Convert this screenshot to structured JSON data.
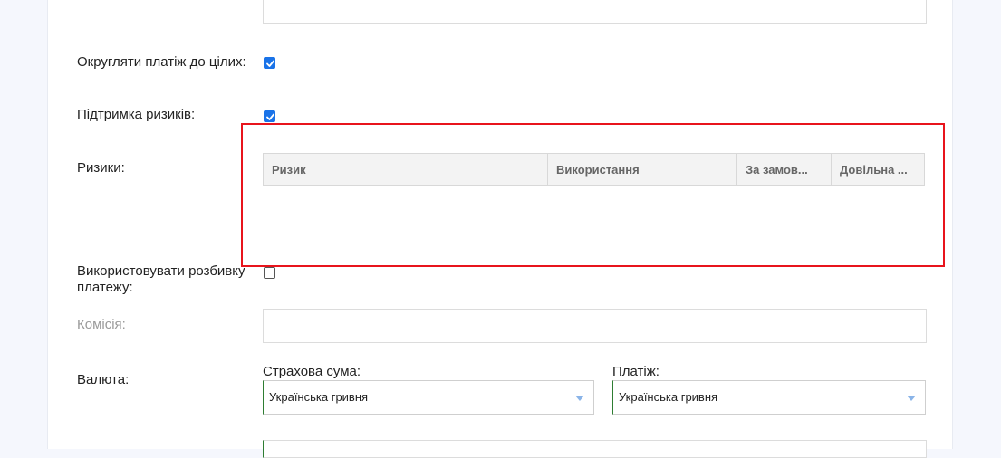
{
  "form": {
    "round_payment_label": "Округляти платіж до цілих:",
    "round_payment_checked": true,
    "risk_support_label": "Підтримка ризиків:",
    "risk_support_checked": true,
    "risks_label": "Ризики:",
    "risks_grid": {
      "columns": [
        "Ризик",
        "Використання",
        "За замов...",
        "Довільна ..."
      ]
    },
    "payment_split_label": "Використовувати розбивку платежу:",
    "payment_split_checked": false,
    "commission_label": "Комісія:",
    "commission_value": "",
    "currency_label": "Валюта:",
    "insured_sum_label": "Страхова сума:",
    "insured_sum_currency": "Українська гривня",
    "payment_label": "Платіж:",
    "payment_currency": "Українська гривня"
  },
  "colors": {
    "highlight": "#e8141c",
    "checkbox": "#1a73e8"
  },
  "icons": {
    "checked": "checkmark-icon",
    "dropdown": "chevron-down-icon"
  }
}
